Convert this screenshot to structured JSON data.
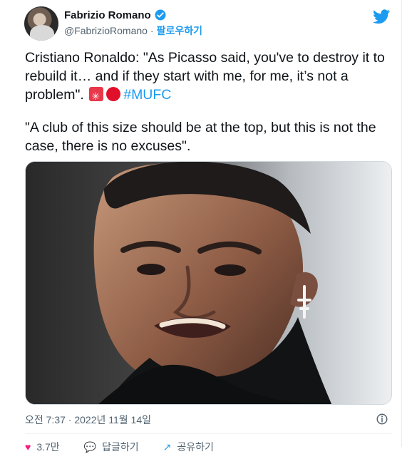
{
  "author": {
    "name": "Fabrizio Romano",
    "handle": "@FabrizioRomano",
    "separator": "·",
    "follow_label": "팔로우하기",
    "verified_color": "#1d9bf0"
  },
  "tweet": {
    "paragraph1_text": "Cristiano Ronaldo: \"As Picasso said, you've to destroy it to rebuild it… and if they start with me, for me, it’s not a problem\".",
    "hashtag": "#MUFC",
    "paragraph2_text": "\"A club of this size should be at the top, but this is not the case, there is no excuses\"."
  },
  "media": {
    "icon": "photo"
  },
  "meta": {
    "timestamp": "오전 7:37 · 2022년 11월 14일"
  },
  "actions": {
    "likes": "3.7만",
    "reply_label": "답글하기",
    "share_label": "공유하기"
  },
  "icons": {
    "twitter": "twitter-bird-icon",
    "info": "info-icon",
    "siren": "siren-emoji",
    "red_circle": "red-circle-emoji"
  },
  "colors": {
    "accent": "#1d9bf0",
    "text": "#0f1419",
    "muted": "#536471",
    "like": "#f91880"
  }
}
